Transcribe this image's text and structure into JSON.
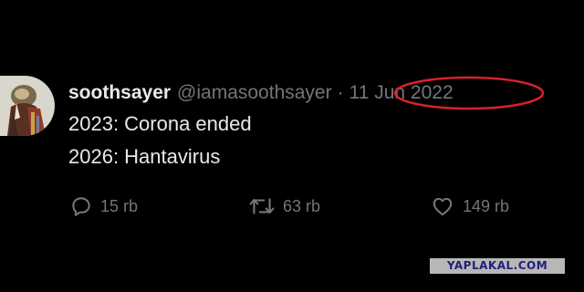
{
  "tweet": {
    "display_name": "soothsayer",
    "handle": "@iamasoothsayer",
    "separator": "·",
    "date": "11 Jun 2022",
    "lines": [
      "2023: Corona ended",
      "2026: Hantavirus"
    ]
  },
  "actions": {
    "reply_count": "15 rb",
    "retweet_count": "63 rb",
    "like_count": "149 rb"
  },
  "icons": {
    "reply": "speech-bubble-icon",
    "retweet": "retweet-arrows-icon",
    "like": "heart-icon"
  },
  "annotation": {
    "ellipse_color": "#d8202a"
  },
  "watermark": {
    "text": "YAPLAKAL.COM"
  },
  "colors": {
    "background": "#000000",
    "primary_text": "#e7e9ea",
    "secondary_text": "#71767b"
  }
}
